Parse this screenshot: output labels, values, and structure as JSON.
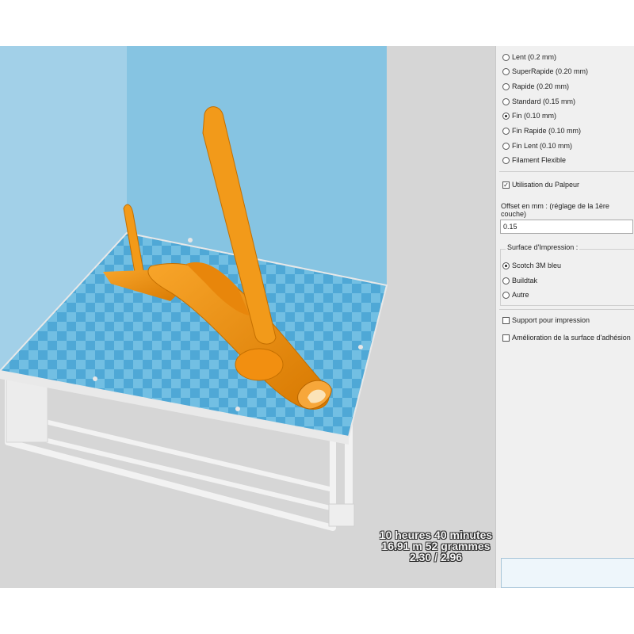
{
  "print_info": {
    "time": "10 heures 40 minutes",
    "filament": "16.91 m 52 grammes",
    "layers": "2.30 / 2.96"
  },
  "quality_options": [
    {
      "label": "Lent (0.2 mm)",
      "selected": false
    },
    {
      "label": "SuperRapide (0.20 mm)",
      "selected": false
    },
    {
      "label": "Rapide (0.20 mm)",
      "selected": false
    },
    {
      "label": "Standard (0.15 mm)",
      "selected": false
    },
    {
      "label": "Fin (0.10 mm)",
      "selected": true
    },
    {
      "label": "Fin Rapide (0.10 mm)",
      "selected": false
    },
    {
      "label": "Fin Lent (0.10 mm)",
      "selected": false
    },
    {
      "label": "Filament Flexible",
      "selected": false
    }
  ],
  "probe": {
    "label": "Utilisation du Palpeur",
    "checked": true
  },
  "offset": {
    "label": "Offset en mm : (réglage de la 1ère couche)",
    "value": "0.15"
  },
  "surface": {
    "title": "Surface d'Impression :",
    "options": [
      {
        "label": "Scotch 3M bleu",
        "selected": true
      },
      {
        "label": "Buildtak",
        "selected": false
      },
      {
        "label": "Autre",
        "selected": false
      }
    ]
  },
  "support": {
    "label": "Support pour impression",
    "checked": false
  },
  "adhesion": {
    "label": "Amélioration de la surface d'adhésion",
    "checked": false
  },
  "colors": {
    "model": "#f5930c",
    "bed": "#5fb3d9",
    "volume": "#8ccbe6"
  }
}
